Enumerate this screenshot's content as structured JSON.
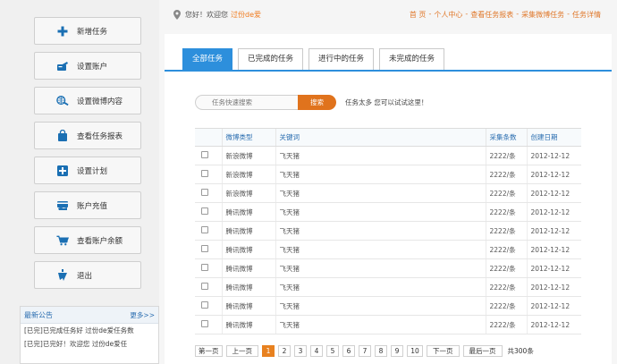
{
  "sidebar": {
    "menu": [
      {
        "label": "新增任务",
        "icon": "plus-icon"
      },
      {
        "label": "设置账户",
        "icon": "account-card-icon"
      },
      {
        "label": "设置微博内容",
        "icon": "globe-search-icon"
      },
      {
        "label": "查看任务报表",
        "icon": "shopping-bag-icon"
      },
      {
        "label": "设置计划",
        "icon": "plus-box-icon"
      },
      {
        "label": "账户充值",
        "icon": "recharge-card-icon"
      },
      {
        "label": "查看账户余额",
        "icon": "cart-icon"
      },
      {
        "label": "退出",
        "icon": "exit-arrow-icon"
      }
    ],
    "notice": {
      "title": "最新公告",
      "more": "更多>>",
      "items": [
        "[已完]已完成任务好 过份de爱任务数",
        "[已完]已完好！欢迎您 过份de爱任"
      ]
    }
  },
  "topbar": {
    "greeting": "您好！欢迎您",
    "username": "过份de爱",
    "breadcrumbs": [
      "首 页",
      "个人中心",
      "查看任务报表",
      "采集微博任务",
      "任务详情"
    ],
    "separator": "-"
  },
  "tabs": [
    {
      "label": "全部任务",
      "active": true
    },
    {
      "label": "已完成的任务",
      "active": false
    },
    {
      "label": "进行中的任务",
      "active": false
    },
    {
      "label": "未完成的任务",
      "active": false
    }
  ],
  "search": {
    "placeholder": "任务快速搜索",
    "button": "搜索",
    "hint": "任务太多 您可以试试这里！"
  },
  "table": {
    "headers": [
      "",
      "微博类型",
      "关键词",
      "采集条数",
      "创建日期"
    ],
    "rows": [
      {
        "type": "新浪微博",
        "keyword": "飞天猪",
        "count": "2222/条",
        "date": "2012-12-12"
      },
      {
        "type": "新浪微博",
        "keyword": "飞天猪",
        "count": "2222/条",
        "date": "2012-12-12"
      },
      {
        "type": "新浪微博",
        "keyword": "飞天猪",
        "count": "2222/条",
        "date": "2012-12-12"
      },
      {
        "type": "腾讯微博",
        "keyword": "飞天猪",
        "count": "2222/条",
        "date": "2012-12-12"
      },
      {
        "type": "腾讯微博",
        "keyword": "飞天猪",
        "count": "2222/条",
        "date": "2012-12-12"
      },
      {
        "type": "腾讯微博",
        "keyword": "飞天猪",
        "count": "2222/条",
        "date": "2012-12-12"
      },
      {
        "type": "腾讯微博",
        "keyword": "飞天猪",
        "count": "2222/条",
        "date": "2012-12-12"
      },
      {
        "type": "腾讯微博",
        "keyword": "飞天猪",
        "count": "2222/条",
        "date": "2012-12-12"
      },
      {
        "type": "腾讯微博",
        "keyword": "飞天猪",
        "count": "2222/条",
        "date": "2012-12-12"
      },
      {
        "type": "腾讯微博",
        "keyword": "飞天猪",
        "count": "2222/条",
        "date": "2012-12-12"
      }
    ]
  },
  "pager": {
    "first": "第一页",
    "prev": "上一页",
    "pages": [
      "1",
      "2",
      "3",
      "4",
      "5",
      "6",
      "7",
      "8",
      "9",
      "10"
    ],
    "current": "1",
    "next": "下一页",
    "last": "最后一页",
    "total": "共300条"
  },
  "colors": {
    "accent_blue": "#2d8fdc",
    "accent_orange": "#e0731d",
    "link_blue": "#2a6db0",
    "icon_blue": "#1a6fb3"
  }
}
